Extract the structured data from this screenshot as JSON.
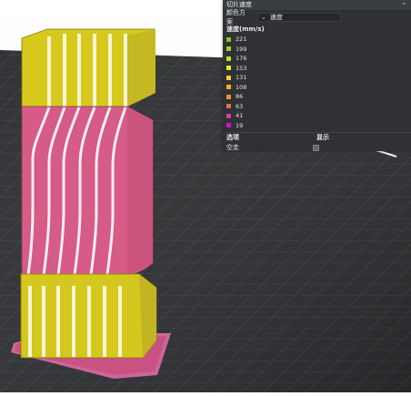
{
  "panel": {
    "title": "切片速度",
    "color_scheme_label": "颜色方案",
    "color_scheme_value": "速度",
    "unit_label": "速度(mm/s)",
    "legend": [
      {
        "value": "221",
        "color": "#7fc61a"
      },
      {
        "value": "199",
        "color": "#96d61f"
      },
      {
        "value": "176",
        "color": "#bfe02b"
      },
      {
        "value": "153",
        "color": "#e7e72c"
      },
      {
        "value": "131",
        "color": "#f0cf2a"
      },
      {
        "value": "108",
        "color": "#f0b22b"
      },
      {
        "value": "86",
        "color": "#f0912b"
      },
      {
        "value": "63",
        "color": "#e66b52"
      },
      {
        "value": "41",
        "color": "#e13a98"
      },
      {
        "value": "19",
        "color": "#d014c9"
      }
    ],
    "options_col_label": "选项",
    "display_col_label": "显示",
    "option_row_label": "空走",
    "option_row_checked": false
  },
  "colors": {
    "panel_bg": "#2f3134",
    "model_yellow": "#d9cc1b",
    "model_pink": "#d95d88",
    "bed_grid": "#4a4b4f",
    "bed_base": "#2f3134"
  }
}
